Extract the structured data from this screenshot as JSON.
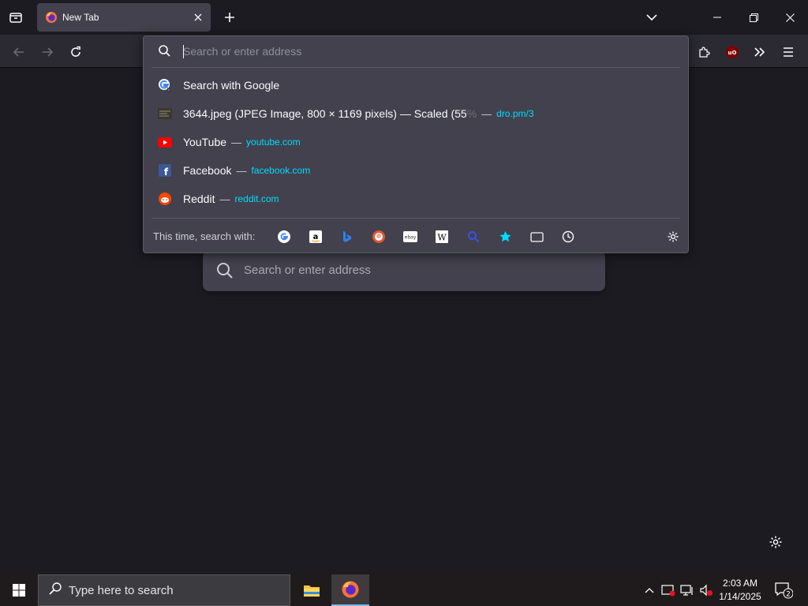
{
  "browser": {
    "tab": {
      "title": "New Tab"
    }
  },
  "urlbar": {
    "placeholder": "Search or enter address",
    "results": [
      {
        "icon": "google-icon",
        "title": "Search with Google",
        "url": ""
      },
      {
        "icon": "image-thumbnail-icon",
        "title": "3644.jpeg (JPEG Image, 800 × 1169 pixels) — Scaled (55",
        "fade": "%",
        "url": "dro.pm/3"
      },
      {
        "icon": "youtube-icon",
        "title": "YouTube",
        "url": "youtube.com"
      },
      {
        "icon": "facebook-icon",
        "title": "Facebook",
        "url": "facebook.com"
      },
      {
        "icon": "reddit-icon",
        "title": "Reddit",
        "url": "reddit.com"
      }
    ],
    "dash": "—",
    "oneoffs_label": "This time, search with:",
    "oneoffs": [
      "google-icon",
      "amazon-icon",
      "bing-icon",
      "duckduckgo-icon",
      "ebay-icon",
      "wikipedia-icon",
      "search-engine-icon",
      "bookmarks-icon",
      "tabs-icon",
      "history-icon"
    ]
  },
  "content": {
    "search_placeholder": "Search or enter address"
  },
  "taskbar": {
    "search_placeholder": "Type here to search",
    "time": "2:03 AM",
    "date": "1/14/2025",
    "notification_count": "2"
  },
  "colors": {
    "accent": "#00ddff",
    "tab_bg": "#42414d",
    "page_bg": "#1c1b22"
  }
}
